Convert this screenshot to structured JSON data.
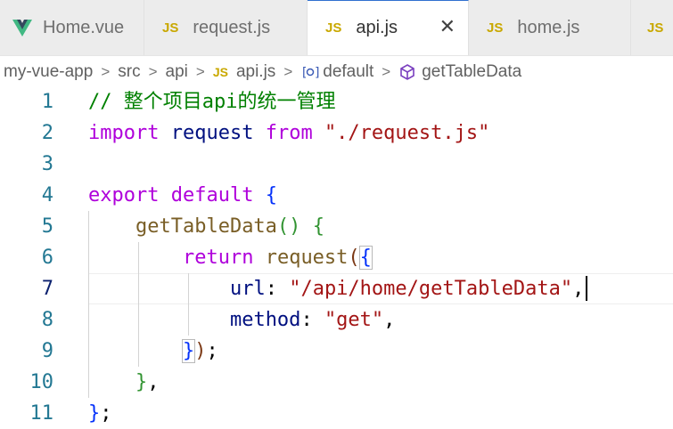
{
  "tabs": [
    {
      "label": "Home.vue",
      "icon": "vue-icon",
      "active": false
    },
    {
      "label": "request.js",
      "icon": "js-icon",
      "active": false
    },
    {
      "label": "api.js",
      "icon": "js-icon",
      "active": true
    },
    {
      "label": "home.js",
      "icon": "js-icon",
      "active": false
    },
    {
      "label": "",
      "icon": "js-icon",
      "active": false
    }
  ],
  "icon_text": {
    "js": "JS"
  },
  "close_glyph": "✕",
  "breadcrumb": {
    "items": [
      "my-vue-app",
      "src",
      "api",
      "api.js",
      "default",
      "getTableData"
    ],
    "separator": ">"
  },
  "editor": {
    "current_line": 7,
    "lines": [
      {
        "n": "1",
        "tokens": [
          {
            "t": "// 整个项目api的统一管理",
            "c": "comment"
          }
        ]
      },
      {
        "n": "2",
        "tokens": [
          {
            "t": "import",
            "c": "key"
          },
          {
            "t": " ",
            "c": "punct"
          },
          {
            "t": "request",
            "c": "var"
          },
          {
            "t": " ",
            "c": "punct"
          },
          {
            "t": "from",
            "c": "key"
          },
          {
            "t": " ",
            "c": "punct"
          },
          {
            "t": "\"./request.js\"",
            "c": "str"
          }
        ]
      },
      {
        "n": "3",
        "tokens": []
      },
      {
        "n": "4",
        "tokens": [
          {
            "t": "export",
            "c": "key"
          },
          {
            "t": " ",
            "c": "punct"
          },
          {
            "t": "default",
            "c": "key"
          },
          {
            "t": " ",
            "c": "punct"
          },
          {
            "t": "{",
            "c": "b1"
          }
        ]
      },
      {
        "n": "5",
        "tokens": [
          {
            "t": "    ",
            "c": "punct"
          },
          {
            "t": "getTableData",
            "c": "fn"
          },
          {
            "t": "()",
            "c": "b2"
          },
          {
            "t": " ",
            "c": "punct"
          },
          {
            "t": "{",
            "c": "b2"
          }
        ]
      },
      {
        "n": "6",
        "tokens": [
          {
            "t": "        ",
            "c": "punct"
          },
          {
            "t": "return",
            "c": "key"
          },
          {
            "t": " ",
            "c": "punct"
          },
          {
            "t": "request",
            "c": "fn"
          },
          {
            "t": "(",
            "c": "b3"
          },
          {
            "t": "{",
            "c": "b1",
            "m": true
          }
        ]
      },
      {
        "n": "7",
        "tokens": [
          {
            "t": "            ",
            "c": "punct"
          },
          {
            "t": "url",
            "c": "var"
          },
          {
            "t": ": ",
            "c": "punct"
          },
          {
            "t": "\"/api/home/getTableData\"",
            "c": "str"
          },
          {
            "t": ",",
            "c": "punct"
          }
        ]
      },
      {
        "n": "8",
        "tokens": [
          {
            "t": "            ",
            "c": "punct"
          },
          {
            "t": "method",
            "c": "var"
          },
          {
            "t": ": ",
            "c": "punct"
          },
          {
            "t": "\"get\"",
            "c": "str"
          },
          {
            "t": ",",
            "c": "punct"
          }
        ]
      },
      {
        "n": "9",
        "tokens": [
          {
            "t": "        ",
            "c": "punct"
          },
          {
            "t": "}",
            "c": "b1",
            "m": true
          },
          {
            "t": ")",
            "c": "b3"
          },
          {
            "t": ";",
            "c": "punct"
          }
        ]
      },
      {
        "n": "10",
        "tokens": [
          {
            "t": "    ",
            "c": "punct"
          },
          {
            "t": "}",
            "c": "b2"
          },
          {
            "t": ",",
            "c": "punct"
          }
        ]
      },
      {
        "n": "11",
        "tokens": [
          {
            "t": "}",
            "c": "b1"
          },
          {
            "t": ";",
            "c": "punct"
          }
        ]
      }
    ]
  }
}
